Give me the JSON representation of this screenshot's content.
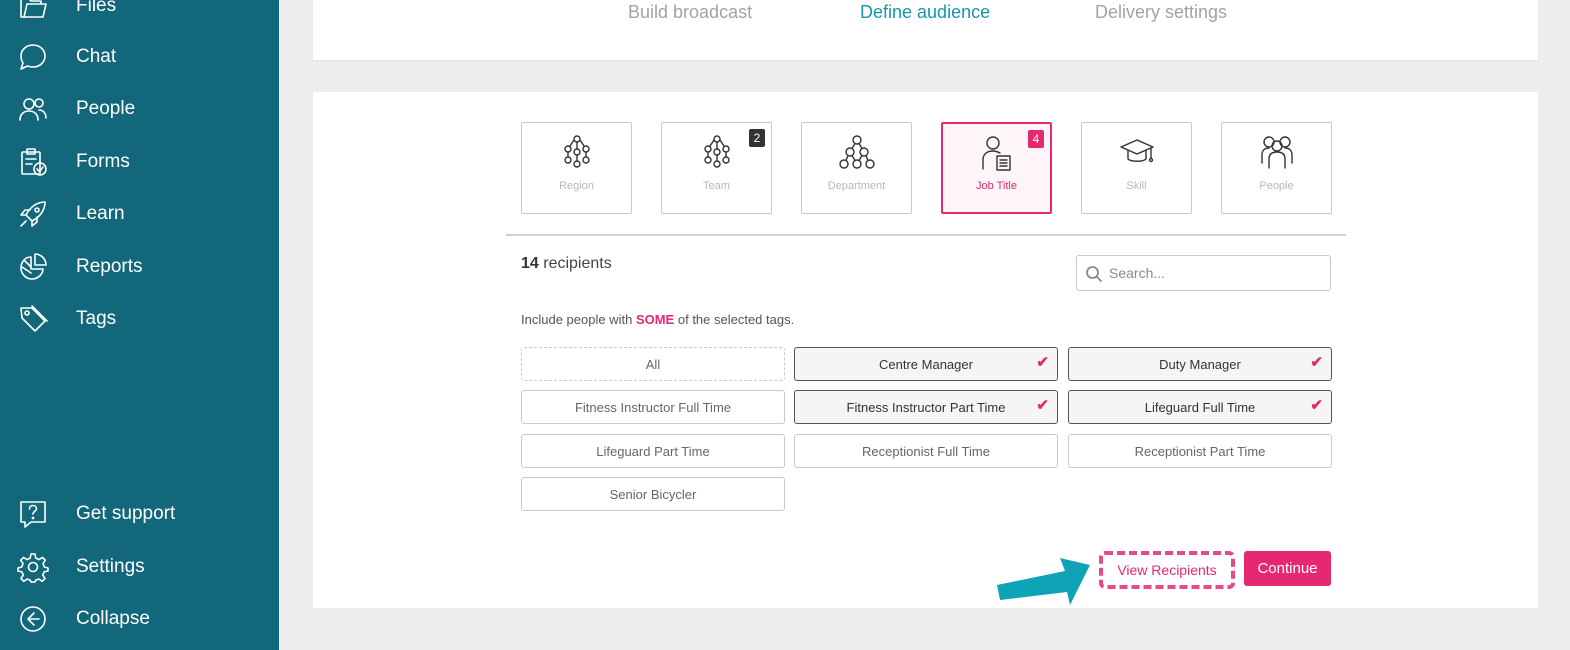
{
  "sidebar": {
    "items": [
      {
        "label": "Files",
        "icon": "folder-icon"
      },
      {
        "label": "Chat",
        "icon": "chat-bubble-icon"
      },
      {
        "label": "People",
        "icon": "people-icon"
      },
      {
        "label": "Forms",
        "icon": "clipboard-check-icon"
      },
      {
        "label": "Learn",
        "icon": "rocket-icon"
      },
      {
        "label": "Reports",
        "icon": "pie-chart-icon"
      },
      {
        "label": "Tags",
        "icon": "tags-icon"
      }
    ],
    "bottom": [
      {
        "label": "Get support",
        "icon": "help-icon"
      },
      {
        "label": "Settings",
        "icon": "gear-icon"
      },
      {
        "label": "Collapse",
        "icon": "collapse-arrow-icon"
      }
    ],
    "color": "#12677a"
  },
  "steps": [
    {
      "label": "Build broadcast",
      "active": false
    },
    {
      "label": "Define audience",
      "active": true
    },
    {
      "label": "Delivery settings",
      "active": false
    }
  ],
  "categories": [
    {
      "label": "Region",
      "icon": "region-hierarchy-icon",
      "badge": ""
    },
    {
      "label": "Team",
      "icon": "team-hierarchy-icon",
      "badge": "2"
    },
    {
      "label": "Department",
      "icon": "department-hierarchy-icon",
      "badge": ""
    },
    {
      "label": "Job Title",
      "icon": "job-title-icon",
      "badge": "4"
    },
    {
      "label": "Skill",
      "icon": "graduation-cap-icon",
      "badge": ""
    },
    {
      "label": "People",
      "icon": "people-group-icon",
      "badge": ""
    }
  ],
  "recipients": {
    "count": "14",
    "label": "recipients"
  },
  "search": {
    "placeholder": "Search..."
  },
  "include": {
    "prefix": "Include people with",
    "emphasis": "SOME",
    "suffix": "of the selected tags."
  },
  "tags": [
    {
      "label": "All",
      "selected": false
    },
    {
      "label": "Centre Manager",
      "selected": true
    },
    {
      "label": "Duty Manager",
      "selected": true
    },
    {
      "label": "Fitness Instructor Full Time",
      "selected": false
    },
    {
      "label": "Fitness Instructor Part Time",
      "selected": true
    },
    {
      "label": "Lifeguard Full Time",
      "selected": true
    },
    {
      "label": "Lifeguard Part Time",
      "selected": false
    },
    {
      "label": "Receptionist Full Time",
      "selected": false
    },
    {
      "label": "Receptionist Part Time",
      "selected": false
    },
    {
      "label": "Senior Bicycler",
      "selected": false
    }
  ],
  "check_glyph": "✔",
  "actions": {
    "view": "View Recipients",
    "continue": "Continue"
  },
  "colors": {
    "accent": "#e5286f",
    "teal": "#1596ad",
    "arrow": "#0fa3b8"
  }
}
